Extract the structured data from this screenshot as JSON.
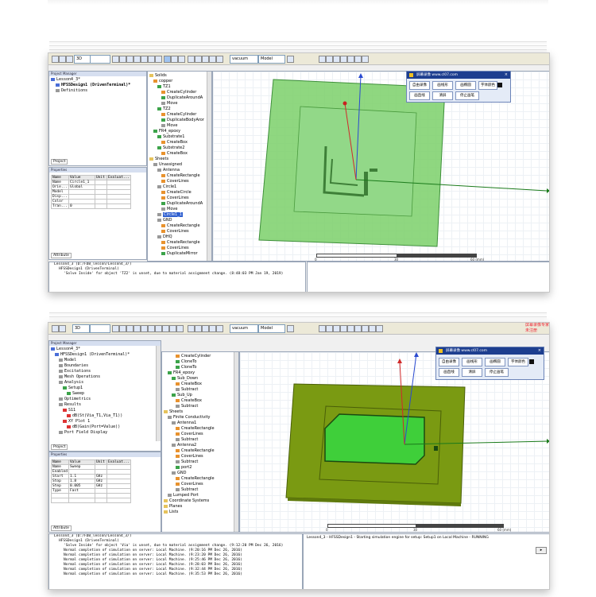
{
  "screen1": {
    "toolbar": {
      "sel_3d": "3D",
      "sel_material": "vacuum",
      "sel_model": "Model"
    },
    "project_panel_title": "Project Manager",
    "project_tree": {
      "root": "Lesson4_3*",
      "design": "HFSSDesign1 (DrivenTerminal)*",
      "item": "Definitions"
    },
    "project_tab": "Project",
    "props_title": "Properties",
    "props": {
      "headers": [
        "Name",
        "Value",
        "Unit",
        "Evaluat..."
      ],
      "rows": [
        [
          "Name",
          "Circle1_1",
          "",
          ""
        ],
        [
          "Orie...",
          "Global",
          "",
          ""
        ],
        [
          "Model",
          "",
          "",
          ""
        ],
        [
          "Disp...",
          "",
          "",
          ""
        ],
        [
          "Color",
          "",
          "",
          ""
        ],
        [
          "Tran...",
          "0",
          "",
          ""
        ]
      ]
    },
    "attr_tab": "Attribute",
    "model_tree": [
      {
        "label": "Solids",
        "indent": 0,
        "icon": "folder"
      },
      {
        "label": "copper",
        "indent": 1,
        "icon": "orange"
      },
      {
        "label": "TZ1",
        "indent": 2,
        "icon": "green"
      },
      {
        "label": "CreateCylinder",
        "indent": 3,
        "icon": "orange"
      },
      {
        "label": "DuplicateAroundA",
        "indent": 3,
        "icon": "green"
      },
      {
        "label": "Move",
        "indent": 3,
        "icon": "grey"
      },
      {
        "label": "TZ2",
        "indent": 2,
        "icon": "green"
      },
      {
        "label": "CreateCylinder",
        "indent": 3,
        "icon": "orange"
      },
      {
        "label": "DuplicateBodyAror",
        "indent": 3,
        "icon": "green"
      },
      {
        "label": "Move",
        "indent": 3,
        "icon": "grey"
      },
      {
        "label": "FR4_epoxy",
        "indent": 1,
        "icon": "green"
      },
      {
        "label": "Substrate1",
        "indent": 2,
        "icon": "green"
      },
      {
        "label": "CreateBox",
        "indent": 3,
        "icon": "orange"
      },
      {
        "label": "Substrate2",
        "indent": 2,
        "icon": "green"
      },
      {
        "label": "CreateBox",
        "indent": 3,
        "icon": "orange"
      },
      {
        "label": "Sheets",
        "indent": 0,
        "icon": "folder"
      },
      {
        "label": "Unassigned",
        "indent": 1,
        "icon": "grey"
      },
      {
        "label": "Antenna",
        "indent": 2,
        "icon": "grey"
      },
      {
        "label": "CreateRectangle",
        "indent": 3,
        "icon": "orange"
      },
      {
        "label": "CoverLines",
        "indent": 3,
        "icon": "orange"
      },
      {
        "label": "Circle1",
        "indent": 2,
        "icon": "grey"
      },
      {
        "label": "CreateCircle",
        "indent": 3,
        "icon": "orange"
      },
      {
        "label": "CoverLines",
        "indent": 3,
        "icon": "orange"
      },
      {
        "label": "DuplicateAroundA",
        "indent": 3,
        "icon": "green"
      },
      {
        "label": "Move",
        "indent": 3,
        "icon": "grey"
      },
      {
        "label": "Circle1_1",
        "indent": 2,
        "icon": "grey",
        "selected": true
      },
      {
        "label": "GND",
        "indent": 2,
        "icon": "grey"
      },
      {
        "label": "CreateRectangle",
        "indent": 3,
        "icon": "orange"
      },
      {
        "label": "CoverLines",
        "indent": 3,
        "icon": "orange"
      },
      {
        "label": "DHQ",
        "indent": 2,
        "icon": "grey"
      },
      {
        "label": "CreateRectangle",
        "indent": 3,
        "icon": "orange"
      },
      {
        "label": "CoverLines",
        "indent": 3,
        "icon": "orange"
      },
      {
        "label": "DuplicateMirror",
        "indent": 3,
        "icon": "green"
      }
    ],
    "scale": {
      "v0": "0",
      "v1": "30",
      "v2": "60 (mm)"
    },
    "messages": [
      "Lesson4_3 (D:/FDB_lesson/Lesson4_3/)",
      "HFSSDesign1 (DrivenTerminal)",
      "'Solve Inside' for object 'TZ2' is unset, due to material assignment change. (8:48:03 PM  Jan 19, 2019)"
    ],
    "im": {
      "title": "屏幕录像 www.cl07.com",
      "row1": [
        "自由录像",
        "画线形",
        "画椭圆",
        "字体颜色"
      ],
      "row2": [
        "画直线",
        "清屏",
        "停止画笔"
      ]
    }
  },
  "screen2": {
    "toolbar": {
      "sel_3d": "3D",
      "sel_material": "vacuum",
      "sel_model": "Model"
    },
    "project_panel_title": "Project Manager",
    "project_tree": [
      {
        "label": "Lesson4_3*",
        "indent": 0,
        "icon": "blue"
      },
      {
        "label": "HFSSDesign1 (DrivenTerminal)*",
        "indent": 1,
        "icon": "blue"
      },
      {
        "label": "Model",
        "indent": 2,
        "icon": "grey"
      },
      {
        "label": "Boundaries",
        "indent": 2,
        "icon": "grey"
      },
      {
        "label": "Excitations",
        "indent": 2,
        "icon": "grey"
      },
      {
        "label": "Mesh Operations",
        "indent": 2,
        "icon": "grey"
      },
      {
        "label": "Analysis",
        "indent": 2,
        "icon": "grey"
      },
      {
        "label": "Setup1",
        "indent": 3,
        "icon": "green"
      },
      {
        "label": "Sweep",
        "indent": 4,
        "icon": "green"
      },
      {
        "label": "Optimetrics",
        "indent": 2,
        "icon": "grey"
      },
      {
        "label": "Results",
        "indent": 2,
        "icon": "grey"
      },
      {
        "label": "S11",
        "indent": 3,
        "icon": "red"
      },
      {
        "label": "dB(St(Via_T1,Via_T1))",
        "indent": 4,
        "icon": "red"
      },
      {
        "label": "XY Plot 1",
        "indent": 3,
        "icon": "red"
      },
      {
        "label": "dB(Gain(Port=Value))",
        "indent": 4,
        "icon": "red"
      },
      {
        "label": "Port Field Display",
        "indent": 2,
        "icon": "grey"
      }
    ],
    "project_tab": "Project",
    "props_title": "Properties",
    "props": {
      "headers": [
        "Name",
        "Value",
        "Unit",
        "Evaluat..."
      ],
      "rows": [
        [
          "Name",
          "Sweep",
          "",
          ""
        ],
        [
          "Enabled",
          "",
          "",
          ""
        ],
        [
          "Start",
          "1.1",
          "GHz",
          ""
        ],
        [
          "Stop",
          "1.8",
          "GHz",
          ""
        ],
        [
          "Step",
          "0.005",
          "GHz",
          ""
        ],
        [
          "Type",
          "Fast",
          "",
          ""
        ],
        [
          "",
          "",
          "",
          ""
        ],
        [
          "",
          "",
          "",
          ""
        ]
      ]
    },
    "attr_tab": "Attribute",
    "model_tree": [
      {
        "label": "CreateCylinder",
        "indent": 3,
        "icon": "orange"
      },
      {
        "label": "CloneTo",
        "indent": 3,
        "icon": "green"
      },
      {
        "label": "CloneTo",
        "indent": 3,
        "icon": "green"
      },
      {
        "label": "FR4_epoxy",
        "indent": 1,
        "icon": "green"
      },
      {
        "label": "Sub_Down",
        "indent": 2,
        "icon": "green"
      },
      {
        "label": "CreateBox",
        "indent": 3,
        "icon": "orange"
      },
      {
        "label": "Subtract",
        "indent": 3,
        "icon": "grey"
      },
      {
        "label": "Sub_Up",
        "indent": 2,
        "icon": "green"
      },
      {
        "label": "CreateBox",
        "indent": 3,
        "icon": "orange"
      },
      {
        "label": "Subtract",
        "indent": 3,
        "icon": "grey"
      },
      {
        "label": "Sheets",
        "indent": 0,
        "icon": "folder"
      },
      {
        "label": "Finite Conductivity",
        "indent": 1,
        "icon": "grey"
      },
      {
        "label": "Antenna1",
        "indent": 2,
        "icon": "grey"
      },
      {
        "label": "CreateRectangle",
        "indent": 3,
        "icon": "orange"
      },
      {
        "label": "CoverLines",
        "indent": 3,
        "icon": "orange"
      },
      {
        "label": "Subtract",
        "indent": 3,
        "icon": "grey"
      },
      {
        "label": "Antenna2",
        "indent": 2,
        "icon": "grey"
      },
      {
        "label": "CreateRectangle",
        "indent": 3,
        "icon": "orange"
      },
      {
        "label": "CoverLines",
        "indent": 3,
        "icon": "orange"
      },
      {
        "label": "Subtract",
        "indent": 3,
        "icon": "grey"
      },
      {
        "label": "port2",
        "indent": 3,
        "icon": "green"
      },
      {
        "label": "GND",
        "indent": 2,
        "icon": "grey"
      },
      {
        "label": "CreateRectangle",
        "indent": 3,
        "icon": "orange"
      },
      {
        "label": "CoverLines",
        "indent": 3,
        "icon": "orange"
      },
      {
        "label": "Subtract",
        "indent": 3,
        "icon": "grey"
      },
      {
        "label": "Lumped Port",
        "indent": 1,
        "icon": "grey"
      },
      {
        "label": "Coordinate Systems",
        "indent": 0,
        "icon": "folder"
      },
      {
        "label": "Planes",
        "indent": 0,
        "icon": "folder"
      },
      {
        "label": "Lists",
        "indent": 0,
        "icon": "folder"
      }
    ],
    "scale": {
      "v0": "0",
      "v1": "30",
      "v2": "60 (mm)"
    },
    "messages": [
      "Lesson4_3 (D:/FDB_lesson/Lesson4_3/)",
      "HFSSDesign1 (DrivenTerminal)",
      "'Solve Inside' for object 'Via' is unset, due to material assignment change. (9:12:20 PM  Dec 26, 2016)",
      "Normal completion of simulation on server: Local Machine. (9:20:16 PM  Dec 26, 2016)",
      "Normal completion of simulation on server: Local Machine. (9:23:20 PM  Dec 26, 2016)",
      "Normal completion of simulation on server: Local Machine. (9:25:46 PM  Dec 26, 2016)",
      "Normal completion of simulation on server: Local Machine. (9:28:03 PM  Dec 26, 2016)",
      "Normal completion of simulation on server: Local Machine. (9:32:44 PM  Dec 26, 2016)",
      "Normal completion of simulation on server: Local Machine. (9:35:53 PM  Dec 26, 2016)"
    ],
    "progress_msg": "Lesson4_3 - HFSSDesign1 - Starting simulation engine for setup: Setup1 on Local Machine - RUNNING",
    "im": {
      "title": "屏幕录像 www.cl07.com",
      "row1": [
        "自由录像",
        "画线形",
        "画椭圆",
        "字体颜色"
      ],
      "row2": [
        "画直线",
        "清屏",
        "停止画笔"
      ]
    },
    "red_text": "屏幕录像专家 未注册"
  },
  "colors": {
    "substrate1": "#7bd06a",
    "substrate2": "#7a9a12",
    "patch2": "#3fcf3a",
    "axis_x": "#1a7a1a",
    "axis_y": "#2a4ad0",
    "axis_z": "#d02a2a"
  }
}
